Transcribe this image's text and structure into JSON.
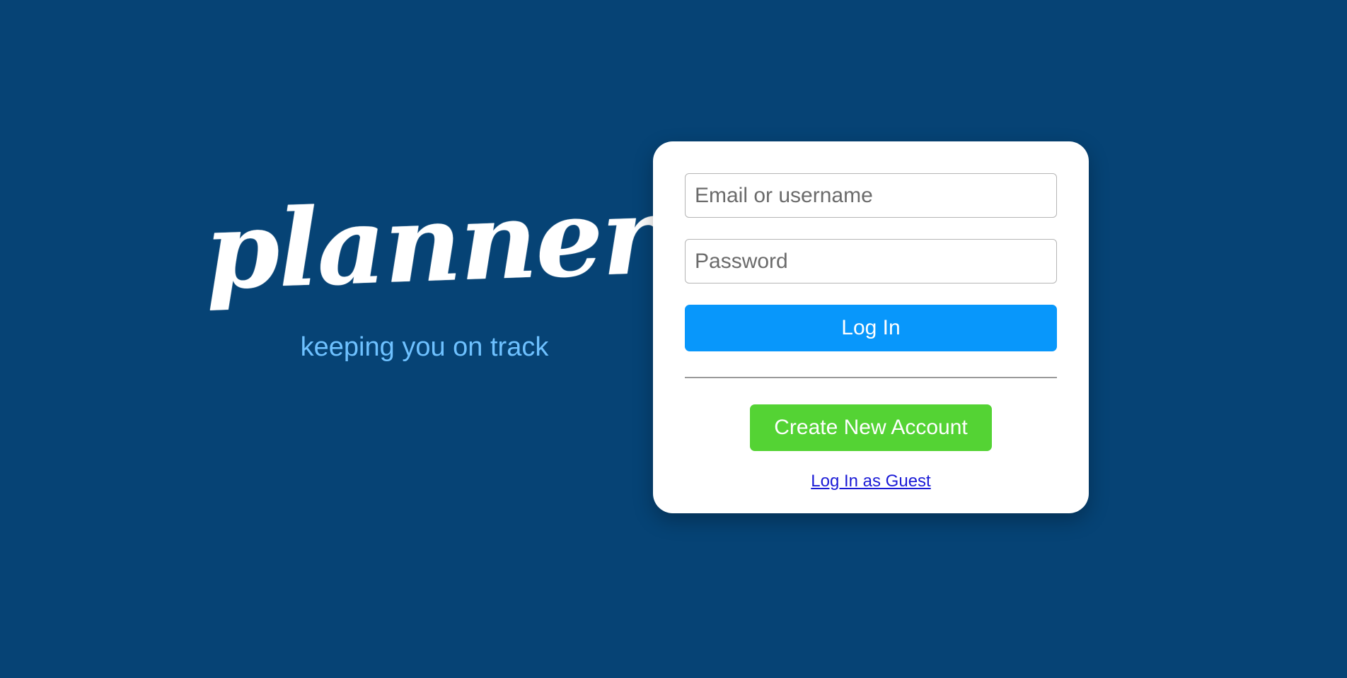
{
  "brand": {
    "logo_text": "plannero",
    "tagline": "keeping you on track"
  },
  "login_form": {
    "email_placeholder": "Email or username",
    "email_value": "",
    "password_placeholder": "Password",
    "password_value": "",
    "login_label": "Log In",
    "create_account_label": "Create New Account",
    "guest_link_label": "Log In as Guest"
  },
  "colors": {
    "background": "#064375",
    "tagline": "#6ec1ff",
    "login_button": "#0897fb",
    "create_button": "#54d334",
    "link": "#1a1ad6"
  }
}
